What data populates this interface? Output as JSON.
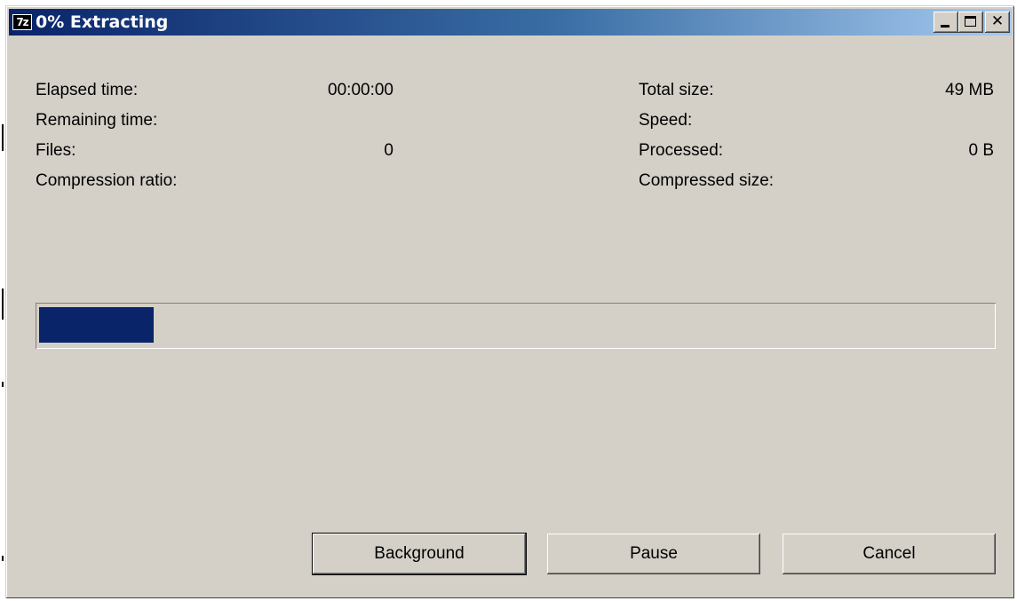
{
  "window": {
    "title": "0% Extracting",
    "icon_label": "7z",
    "controls": [
      "minimize-icon",
      "maximize-icon",
      "close-icon"
    ],
    "close_glyph": "✕"
  },
  "stats": {
    "elapsed_time": {
      "label": "Elapsed time:",
      "value": "00:00:00"
    },
    "remaining_time": {
      "label": "Remaining time:",
      "value": ""
    },
    "files": {
      "label": "Files:",
      "value": "0"
    },
    "compression_ratio": {
      "label": "Compression ratio:",
      "value": ""
    },
    "total_size": {
      "label": "Total size:",
      "value": "49 MB"
    },
    "speed": {
      "label": "Speed:",
      "value": ""
    },
    "processed": {
      "label": "Processed:",
      "value": "0 B"
    },
    "compressed_size": {
      "label": "Compressed size:",
      "value": ""
    }
  },
  "progress": {
    "fraction": 0.12,
    "fill_color": "#0a246a"
  },
  "buttons": {
    "background": "Background",
    "pause": "Pause",
    "cancel": "Cancel"
  },
  "colors": {
    "title_gradient_start": "#0a246a",
    "title_gradient_end": "#a6caf0",
    "window_face": "#d4d0c8"
  }
}
